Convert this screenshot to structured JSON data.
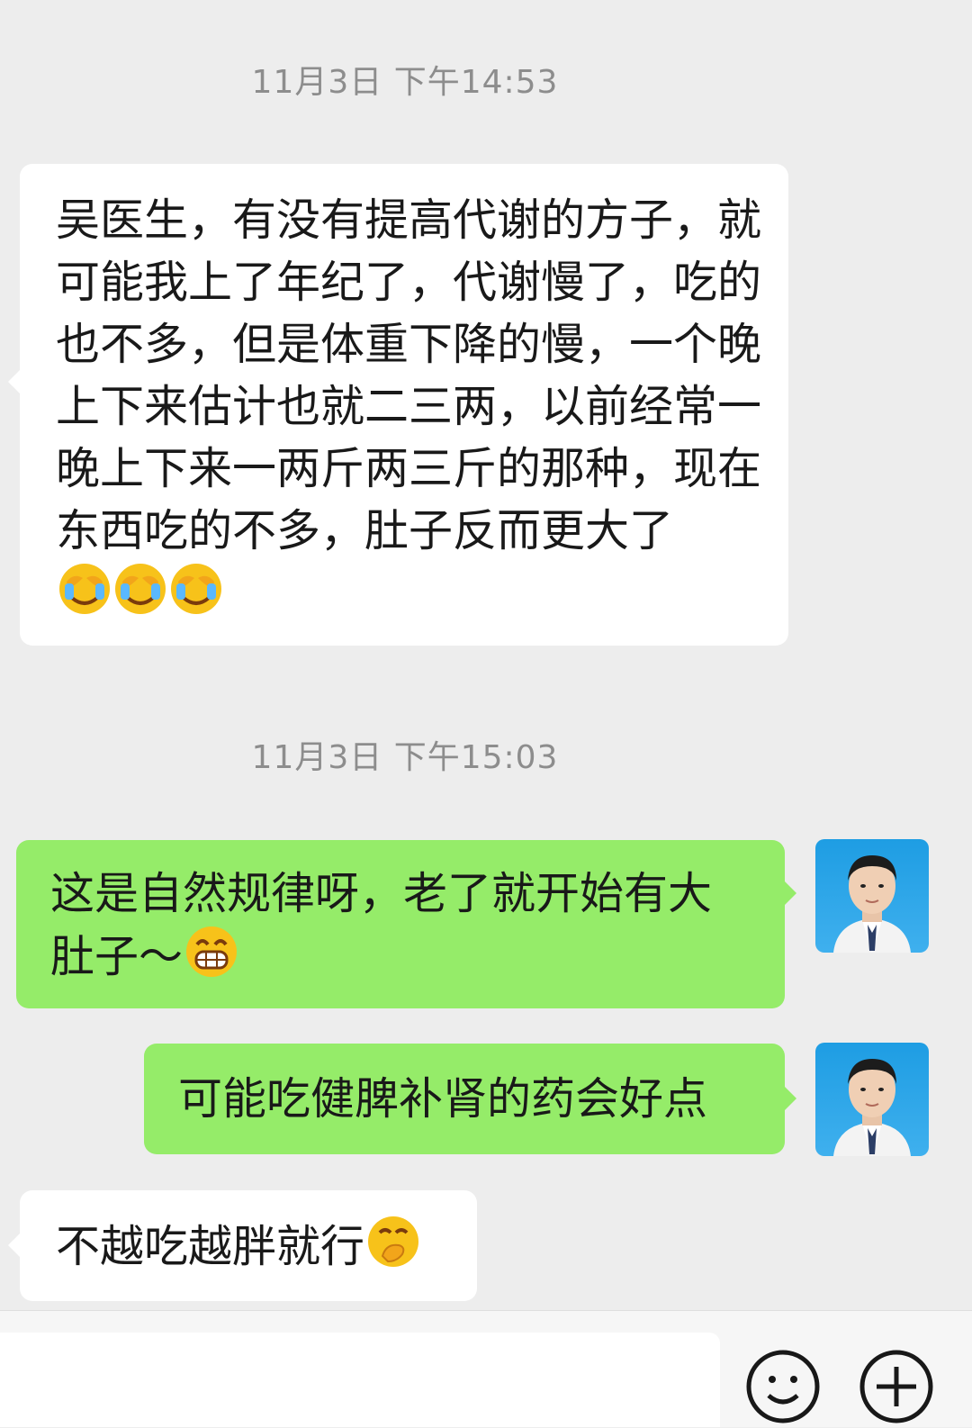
{
  "timestamps": [
    "11月3日 下午14:53",
    "11月3日 下午15:03"
  ],
  "messages": [
    {
      "side": "left",
      "text": "吴医生，有没有提高代谢的方子，就可能我上了年纪了，代谢慢了，吃的也不多，但是体重下降的慢，一个晚上下来估计也就二三两，以前经常一晚上下来一两斤两三斤的那种，现在东西吃的不多，肚子反而更大了",
      "emoji": "face-covering-eyes-crying-emoji ×3"
    },
    {
      "side": "right",
      "text": "这是自然规律呀，老了就开始有大肚子～",
      "emoji": "grinning-emoji"
    },
    {
      "side": "right",
      "text": "可能吃健脾补肾的药会好点",
      "emoji": ""
    },
    {
      "side": "left",
      "text": "不越吃越胖就行",
      "emoji": "thinking-hand-over-mouth-emoji"
    }
  ],
  "input_bar": {
    "icons": [
      "emoji-face-icon",
      "plus-icon"
    ]
  },
  "colors": {
    "background": "#ededed",
    "incoming": "#ffffff",
    "outgoing": "#95ec69",
    "timestamp": "#8d8d8d"
  }
}
